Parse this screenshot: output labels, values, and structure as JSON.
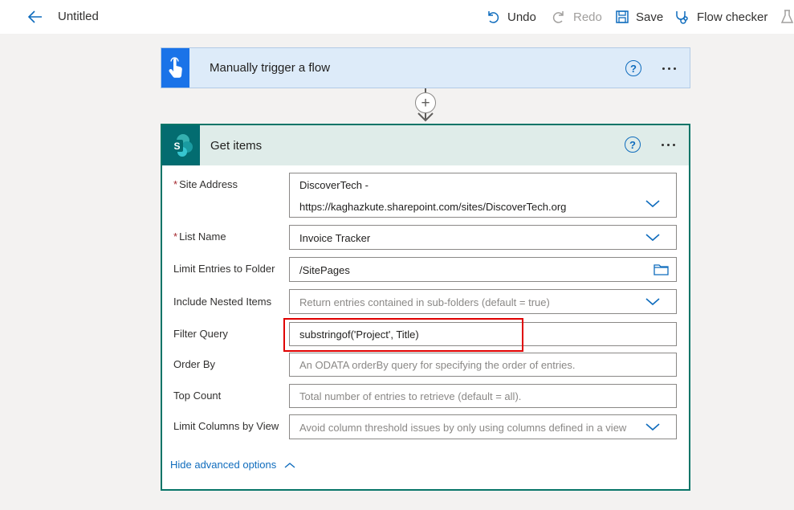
{
  "header": {
    "title": "Untitled",
    "undo": "Undo",
    "redo": "Redo",
    "save": "Save",
    "flow_checker": "Flow checker"
  },
  "trigger": {
    "title": "Manually trigger a flow",
    "help": "?"
  },
  "action": {
    "title": "Get items",
    "help": "?",
    "fields": {
      "site_address": {
        "label": "Site Address",
        "value_line1": "DiscoverTech -",
        "value_line2": "https://kaghazkute.sharepoint.com/sites/DiscoverTech.org"
      },
      "list_name": {
        "label": "List Name",
        "value": "Invoice Tracker"
      },
      "limit_folder": {
        "label": "Limit Entries to Folder",
        "value": "/SitePages"
      },
      "nested": {
        "label": "Include Nested Items",
        "placeholder": "Return entries contained in sub-folders (default = true)"
      },
      "filter": {
        "label": "Filter Query",
        "value": "substringof('Project', Title)"
      },
      "order_by": {
        "label": "Order By",
        "placeholder": "An ODATA orderBy query for specifying the order of entries."
      },
      "top_count": {
        "label": "Top Count",
        "placeholder": "Total number of entries to retrieve (default = all)."
      },
      "limit_view": {
        "label": "Limit Columns by View",
        "placeholder": "Avoid column threshold issues by only using columns defined in a view"
      }
    },
    "hide_advanced": "Hide advanced options"
  },
  "colors": {
    "trigger_bg": "#ddebf9",
    "trigger_icon_bg": "#1a73e8",
    "action_border": "#077568",
    "action_header_bg": "#dfece9",
    "sharepoint_icon": "#036c70",
    "highlight": "#e00000",
    "link": "#0f6cbd"
  },
  "icons": [
    "back-arrow-icon",
    "undo-icon",
    "redo-icon",
    "save-icon",
    "flow-checker-icon",
    "test-flask-icon",
    "hand-pointer-icon",
    "sharepoint-icon",
    "help-icon",
    "more-icon",
    "plus-icon",
    "chevron-down-icon",
    "folder-icon",
    "chevron-up-icon"
  ]
}
